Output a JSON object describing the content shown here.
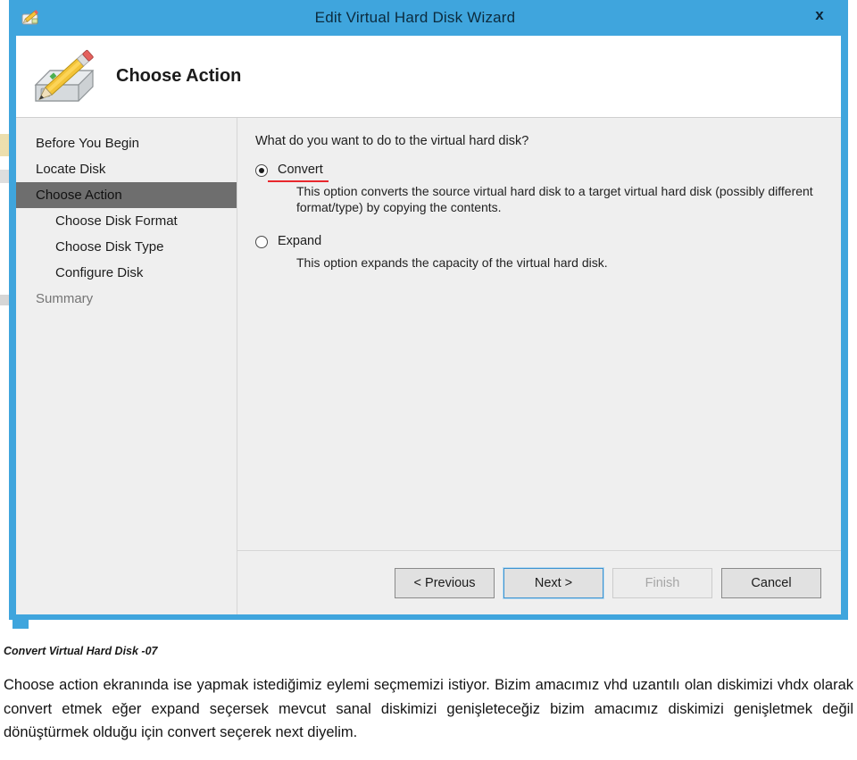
{
  "window": {
    "title": "Edit Virtual Hard Disk Wizard",
    "title_icon": "pencil-disk-icon",
    "close_label": "x"
  },
  "header": {
    "icon": "virtual-hard-disk-pencil-icon",
    "title": "Choose Action"
  },
  "sidebar": {
    "items": [
      {
        "label": "Before You Begin",
        "state": "normal",
        "indent": false
      },
      {
        "label": "Locate Disk",
        "state": "normal",
        "indent": false
      },
      {
        "label": "Choose Action",
        "state": "active",
        "indent": false
      },
      {
        "label": "Choose Disk Format",
        "state": "normal",
        "indent": true
      },
      {
        "label": "Choose Disk Type",
        "state": "normal",
        "indent": true
      },
      {
        "label": "Configure Disk",
        "state": "normal",
        "indent": true
      },
      {
        "label": "Summary",
        "state": "muted",
        "indent": false
      }
    ]
  },
  "content": {
    "question": "What do you want to do to the virtual hard disk?",
    "options": [
      {
        "label": "Convert",
        "selected": true,
        "annotated": true,
        "description": "This option converts the source virtual hard disk to a target virtual hard disk (possibly different format/type) by copying the contents."
      },
      {
        "label": "Expand",
        "selected": false,
        "annotated": false,
        "description": "This option expands the capacity of the virtual hard disk."
      }
    ]
  },
  "footer": {
    "buttons": [
      {
        "label": "< Previous",
        "state": "normal"
      },
      {
        "label": "Next >",
        "state": "focused"
      },
      {
        "label": "Finish",
        "state": "disabled"
      },
      {
        "label": "Cancel",
        "state": "normal"
      }
    ]
  },
  "caption": {
    "title": "Convert Virtual Hard Disk -07",
    "body": "Choose action ekranında ise yapmak istediğimiz eylemi seçmemizi istiyor. Bizim amacımız vhd uzantılı olan diskimizi vhdx olarak convert etmek eğer expand seçersek mevcut sanal diskimizi genişleteceğiz bizim amacımız diskimizi genişletmek değil dönüştürmek olduğu için convert seçerek next diyelim."
  },
  "colors": {
    "title_bar": "#3fa5dd",
    "sidebar_active": "#6e6e6e",
    "annotation_red": "#e8272c",
    "dialog_bg": "#efefef"
  }
}
